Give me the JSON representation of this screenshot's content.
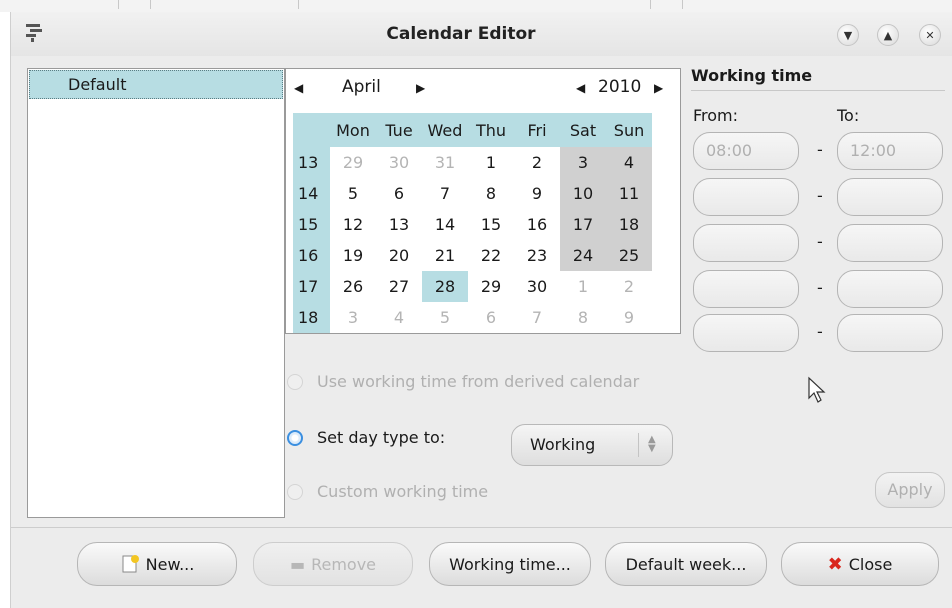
{
  "window": {
    "title": "Calendar Editor"
  },
  "calendars": [
    "Default"
  ],
  "calendar": {
    "month": "April",
    "year": "2010",
    "day_headers": [
      "Mon",
      "Tue",
      "Wed",
      "Thu",
      "Fri",
      "Sat",
      "Sun"
    ],
    "weeks": [
      {
        "num": "13",
        "days": [
          "29",
          "30",
          "31",
          "1",
          "2",
          "3",
          "4"
        ]
      },
      {
        "num": "14",
        "days": [
          "5",
          "6",
          "7",
          "8",
          "9",
          "10",
          "11"
        ]
      },
      {
        "num": "15",
        "days": [
          "12",
          "13",
          "14",
          "15",
          "16",
          "17",
          "18"
        ]
      },
      {
        "num": "16",
        "days": [
          "19",
          "20",
          "21",
          "22",
          "23",
          "24",
          "25"
        ]
      },
      {
        "num": "17",
        "days": [
          "26",
          "27",
          "28",
          "29",
          "30",
          "1",
          "2"
        ]
      },
      {
        "num": "18",
        "days": [
          "3",
          "4",
          "5",
          "6",
          "7",
          "8",
          "9"
        ]
      }
    ],
    "selected_day": "28"
  },
  "working_time": {
    "title": "Working time",
    "from_label": "From:",
    "to_label": "To:",
    "separator": "-",
    "rows": [
      {
        "from": "08:00",
        "to": "12:00"
      },
      {
        "from": "",
        "to": ""
      },
      {
        "from": "",
        "to": ""
      },
      {
        "from": "",
        "to": ""
      },
      {
        "from": "",
        "to": ""
      }
    ],
    "apply_label": "Apply"
  },
  "day_type": {
    "derived_label": "Use working time from derived calendar",
    "set_label": "Set day type to:",
    "custom_label": "Custom working time",
    "selected_option": "Working"
  },
  "buttons": {
    "new": "New...",
    "remove": "Remove",
    "working_time": "Working time...",
    "default_week": "Default week...",
    "close": "Close"
  },
  "colors": {
    "accent": "#b7dde3",
    "weekend": "#d0d0d0",
    "radio_on": "#3b8fe0",
    "close_icon": "#d9261c"
  }
}
